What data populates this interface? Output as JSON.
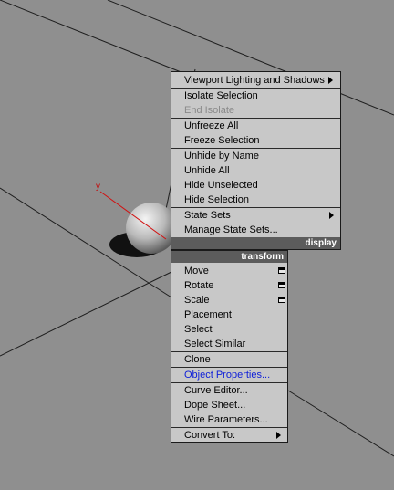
{
  "viewport": {
    "axis_label": "y"
  },
  "quad_upper": {
    "viewport_lighting": "Viewport Lighting and Shadows",
    "isolate_selection": "Isolate Selection",
    "end_isolate": "End Isolate",
    "unfreeze_all": "Unfreeze All",
    "freeze_selection": "Freeze Selection",
    "unhide_by_name": "Unhide by Name",
    "unhide_all": "Unhide All",
    "hide_unselected": "Hide Unselected",
    "hide_selection": "Hide Selection",
    "state_sets": "State Sets",
    "manage_state_sets": "Manage State Sets...",
    "display_header": "display"
  },
  "quad_lower": {
    "transform_header": "transform",
    "move": "Move",
    "rotate": "Rotate",
    "scale": "Scale",
    "placement": "Placement",
    "select": "Select",
    "select_similar": "Select Similar",
    "clone": "Clone",
    "object_properties": "Object Properties...",
    "curve_editor": "Curve Editor...",
    "dope_sheet": "Dope Sheet...",
    "wire_parameters": "Wire Parameters...",
    "convert_to": "Convert To:"
  },
  "colors": {
    "viewport_bg": "#8f8f8f",
    "menu_bg": "#c8c8c8",
    "header_bg": "#5c5c5c",
    "highlight_text": "#1020d8",
    "disabled_text": "#8a8a8a"
  }
}
